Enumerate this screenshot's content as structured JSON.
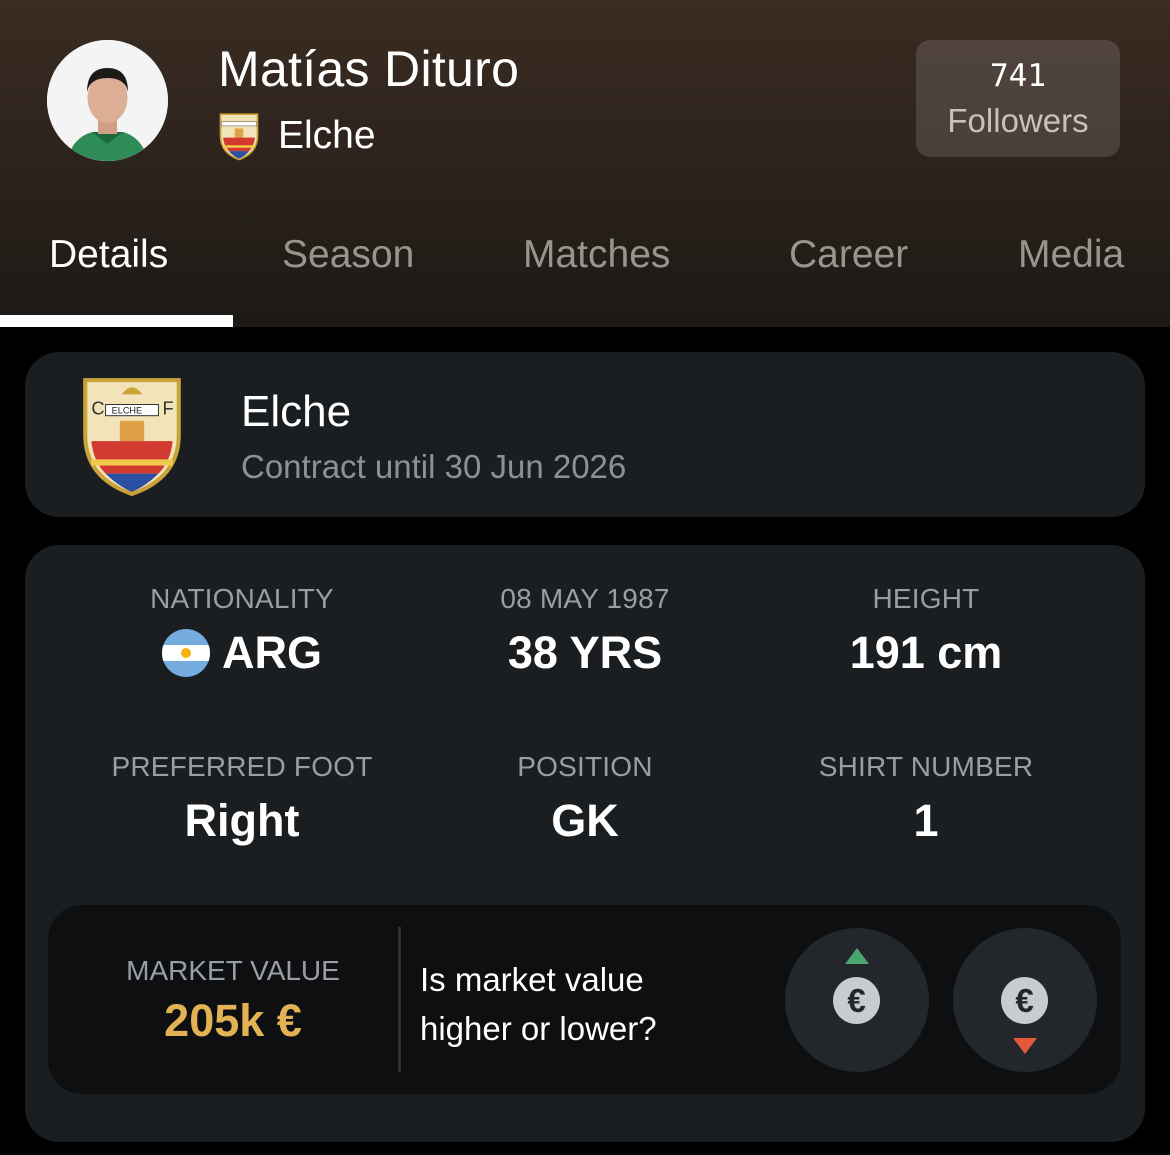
{
  "player": {
    "name": "Matías Dituro",
    "club": "Elche"
  },
  "followers": {
    "count": "741",
    "label": "Followers"
  },
  "tabs": [
    {
      "label": "Details",
      "active": true
    },
    {
      "label": "Season",
      "active": false
    },
    {
      "label": "Matches",
      "active": false
    },
    {
      "label": "Career",
      "active": false
    },
    {
      "label": "Media",
      "active": false
    }
  ],
  "contract": {
    "club": "Elche",
    "until": "Contract until 30 Jun 2026"
  },
  "details": {
    "nationality": {
      "label": "NATIONALITY",
      "value": "ARG",
      "flag_icon": "argentina-flag-icon"
    },
    "birth": {
      "label": "08 MAY 1987",
      "value": "38 YRS"
    },
    "height": {
      "label": "HEIGHT",
      "value": "191 cm"
    },
    "foot": {
      "label": "PREFERRED FOOT",
      "value": "Right"
    },
    "position": {
      "label": "POSITION",
      "value": "GK"
    },
    "shirt": {
      "label": "SHIRT NUMBER",
      "value": "1"
    }
  },
  "market": {
    "label": "MARKET VALUE",
    "value": "205k €",
    "question_line1": "Is market value",
    "question_line2": "higher or lower?",
    "higher_icon": "euro-up-icon",
    "lower_icon": "euro-down-icon",
    "euro_symbol": "€"
  },
  "colors": {
    "accent_gold": "#e2b253",
    "up_green": "#4aa66f",
    "down_red": "#e3593a",
    "card_bg": "#1b1e21"
  }
}
